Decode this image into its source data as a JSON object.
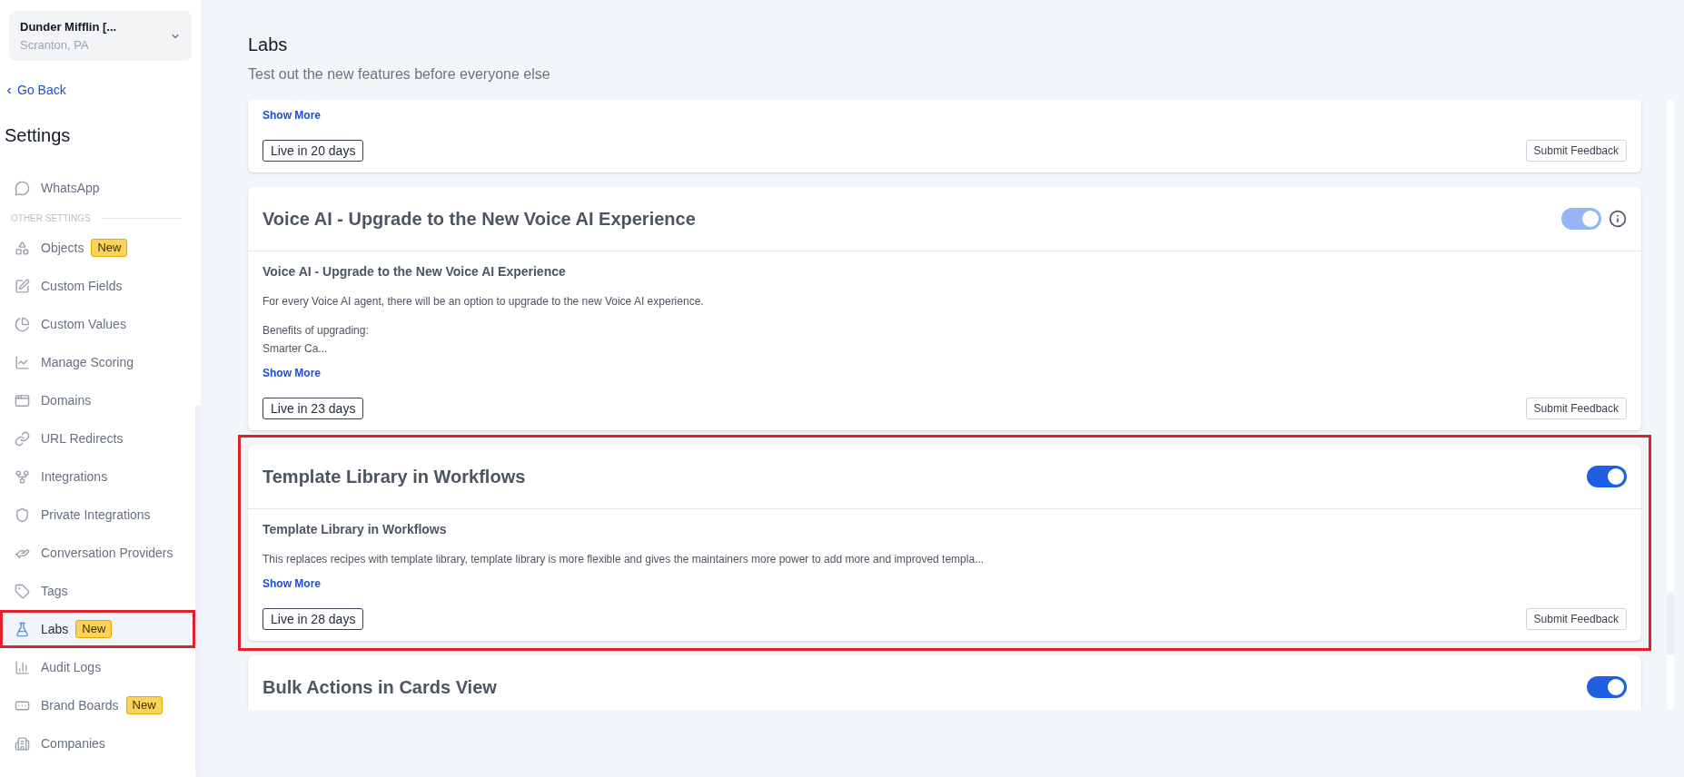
{
  "sidebar": {
    "company": {
      "name": "Dunder Mifflin [...",
      "location": "Scranton, PA"
    },
    "back_link": "Go Back",
    "heading": "Settings",
    "items": [
      {
        "kind": "item",
        "label": "WhatsApp",
        "selected": false
      },
      {
        "kind": "section",
        "label": "OTHER SETTINGS"
      },
      {
        "kind": "item",
        "label": "Objects",
        "badge": "New",
        "selected": false
      },
      {
        "kind": "item",
        "label": "Custom Fields",
        "selected": false
      },
      {
        "kind": "item",
        "label": "Custom Values",
        "selected": false
      },
      {
        "kind": "item",
        "label": "Manage Scoring",
        "selected": false
      },
      {
        "kind": "item",
        "label": "Domains",
        "selected": false
      },
      {
        "kind": "item",
        "label": "URL Redirects",
        "selected": false
      },
      {
        "kind": "item",
        "label": "Integrations",
        "selected": false
      },
      {
        "kind": "item",
        "label": "Private Integrations",
        "selected": false
      },
      {
        "kind": "item",
        "label": "Conversation Providers",
        "selected": false
      },
      {
        "kind": "item",
        "label": "Tags",
        "selected": false
      },
      {
        "kind": "item",
        "label": "Labs",
        "badge": "New",
        "selected": true,
        "highlighted": true
      },
      {
        "kind": "item",
        "label": "Audit Logs",
        "selected": false
      },
      {
        "kind": "item",
        "label": "Brand Boards",
        "badge": "New",
        "selected": false
      },
      {
        "kind": "item",
        "label": "Companies",
        "selected": false
      }
    ]
  },
  "page": {
    "title": "Labs",
    "subtitle": "Test out the new features before everyone else"
  },
  "features": [
    {
      "kind": "tail",
      "show_more": "Show More",
      "live": "Live in 20 days",
      "feedback": "Submit Feedback",
      "highlighted": false
    },
    {
      "kind": "full",
      "title": "Voice AI - Upgrade to the New Voice AI Experience",
      "on": true,
      "disabled": true,
      "info_icon": true,
      "subtitle": "Voice AI - Upgrade to the New Voice AI Experience",
      "paragraphs": [
        "For every Voice AI agent, there will be an option to upgrade to the new Voice AI experience.",
        "Benefits of upgrading:\nSmarter Ca..."
      ],
      "show_more": "Show More",
      "live": "Live in 23 days",
      "feedback": "Submit Feedback",
      "highlighted": false
    },
    {
      "kind": "full",
      "title": "Template Library in Workflows",
      "on": true,
      "disabled": false,
      "info_icon": false,
      "subtitle": "Template Library in Workflows",
      "paragraphs": [
        "This replaces recipes with template library, template library is more flexible and gives the maintainers more power to add more and improved templa..."
      ],
      "show_more": "Show More",
      "live": "Live in 28 days",
      "feedback": "Submit Feedback",
      "highlighted": true
    },
    {
      "kind": "head",
      "title": "Bulk Actions in Cards View",
      "on": true,
      "disabled": false,
      "info_icon": false,
      "highlighted": false
    }
  ]
}
